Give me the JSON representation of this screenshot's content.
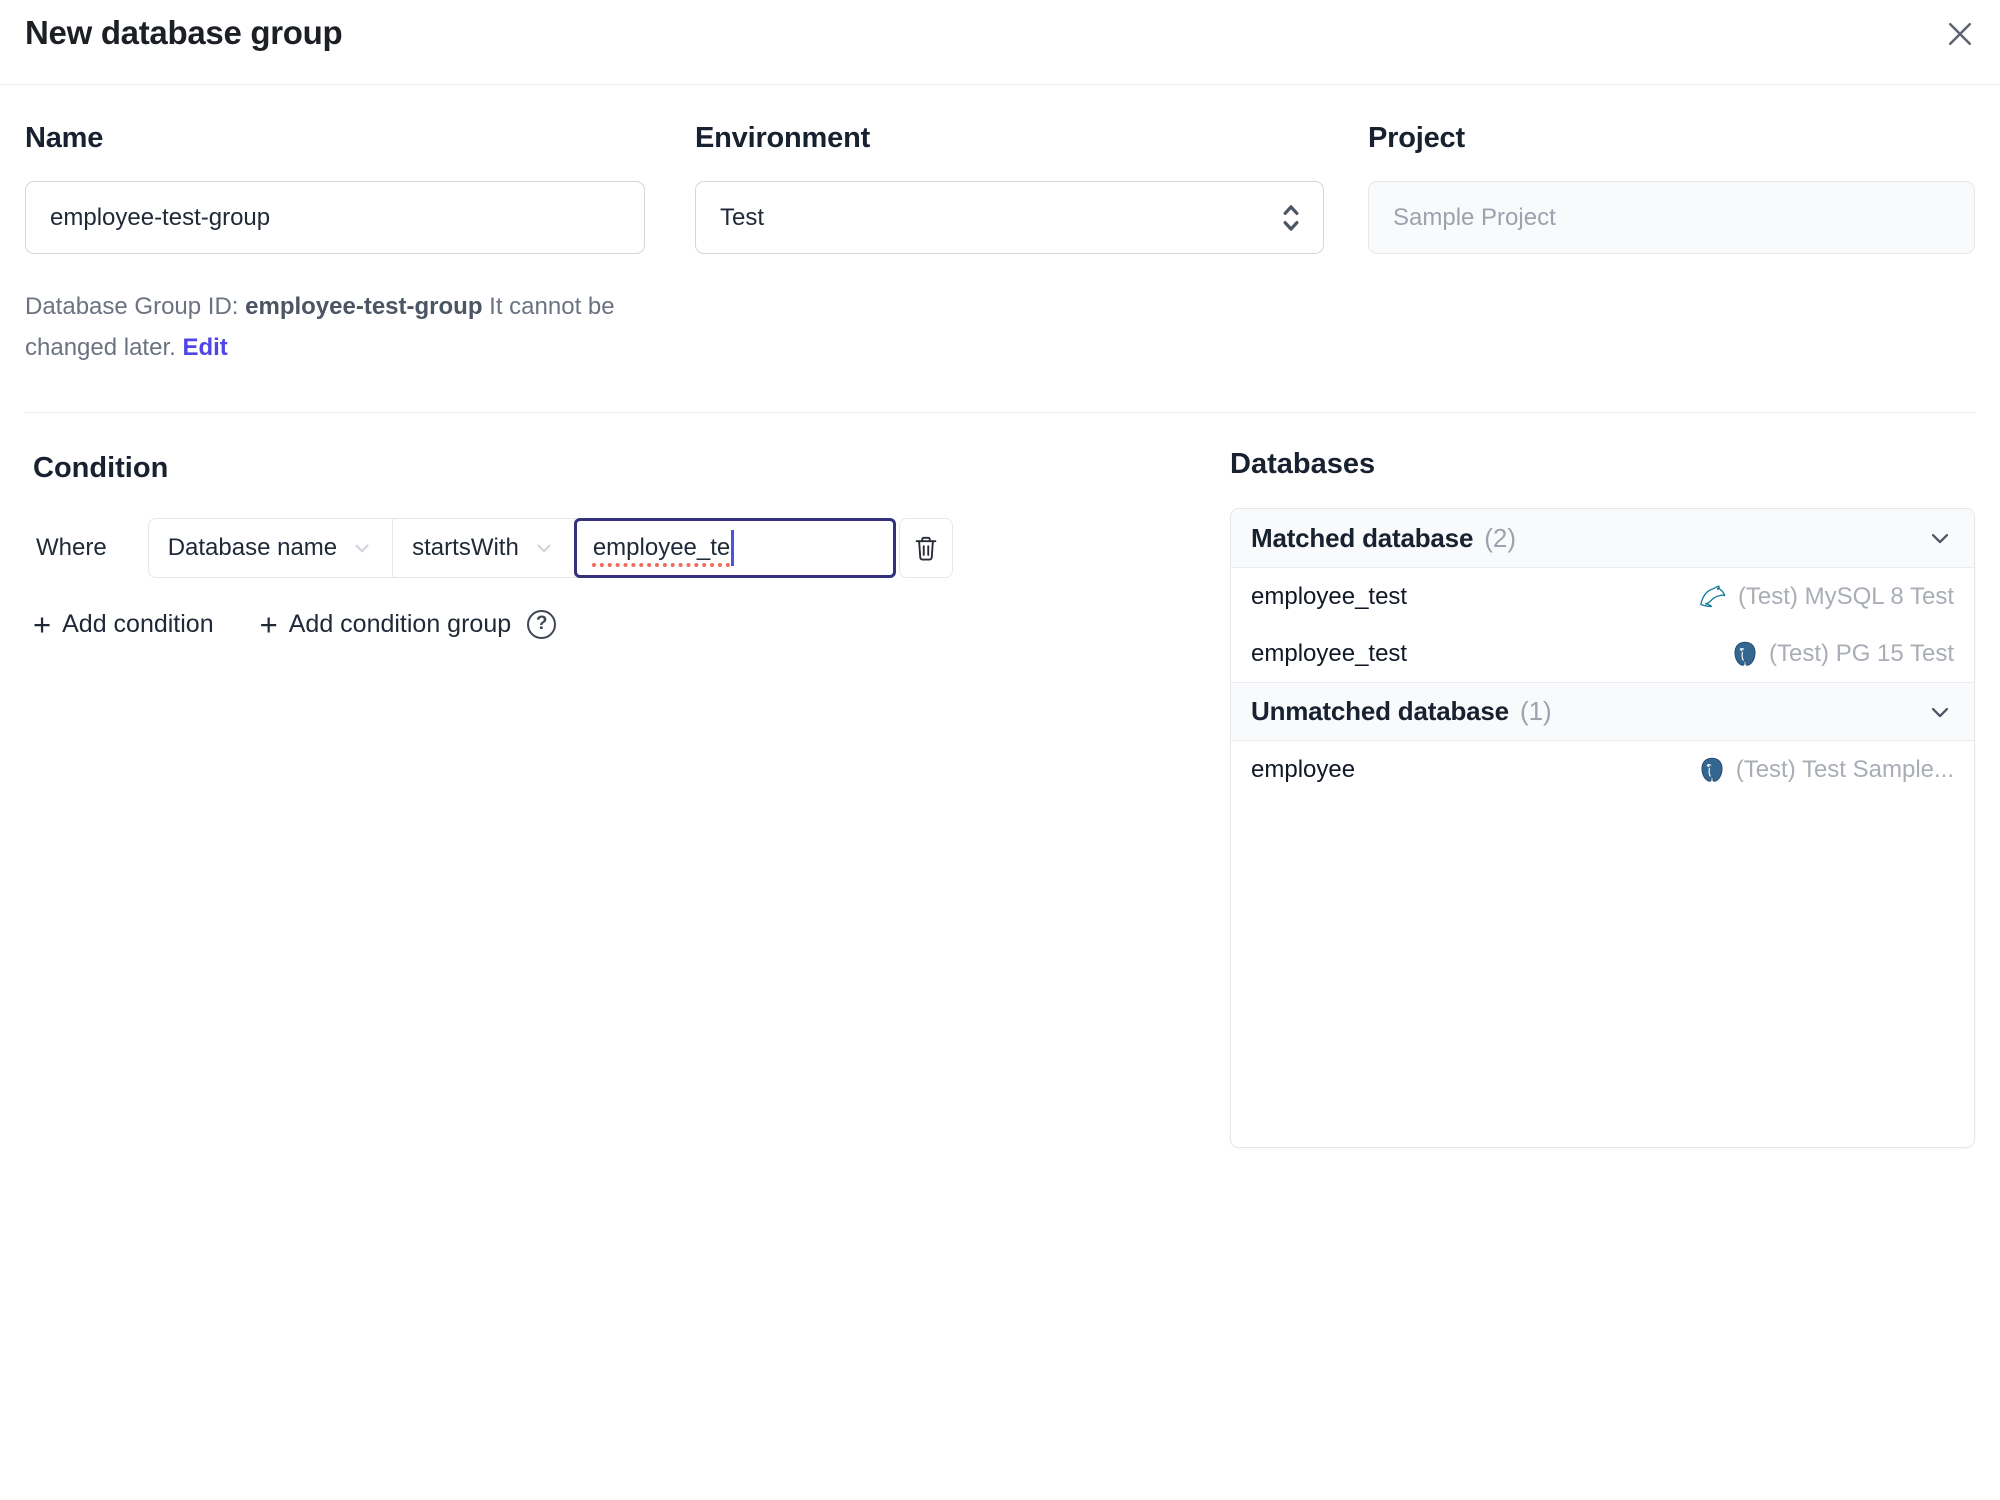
{
  "dialog": {
    "title": "New database group"
  },
  "form": {
    "name": {
      "label": "Name",
      "value": "employee-test-group"
    },
    "environment": {
      "label": "Environment",
      "value": "Test"
    },
    "project": {
      "label": "Project",
      "value": "Sample Project"
    },
    "group_id_note": {
      "prefix": "Database Group ID: ",
      "id": "employee-test-group",
      "suffix": " It cannot be changed later. ",
      "edit_link": "Edit"
    }
  },
  "condition": {
    "heading": "Condition",
    "where_label": "Where",
    "field_selected": "Database name",
    "operator_selected": "startsWith",
    "value": "employee_te",
    "plus_glyph": "+",
    "add_condition_label": "Add condition",
    "add_condition_group_label": "Add condition group",
    "help_glyph": "?"
  },
  "databases": {
    "heading": "Databases",
    "sections": [
      {
        "title": "Matched database",
        "count": "(2)",
        "rows": [
          {
            "name": "employee_test",
            "engine_icon": "mysql-icon",
            "instance": "(Test) MySQL 8 Test"
          },
          {
            "name": "employee_test",
            "engine_icon": "postgres-icon",
            "instance": "(Test) PG 15 Test"
          }
        ]
      },
      {
        "title": "Unmatched database",
        "count": "(1)",
        "rows": [
          {
            "name": "employee",
            "engine_icon": "postgres-icon",
            "instance": "(Test) Test Sample..."
          }
        ]
      }
    ]
  },
  "colors": {
    "accent": "#4f46e5",
    "focus_border": "#34317f",
    "spellcheck_underline": "#ef6a5f",
    "mysql_icon": "#0e7a99",
    "postgres_icon": "#336791",
    "border": "#e5e7eb",
    "header_bg": "#f9fafb",
    "text_primary": "#111827",
    "text_secondary": "#6b7280",
    "text_muted": "#9ca3af"
  }
}
